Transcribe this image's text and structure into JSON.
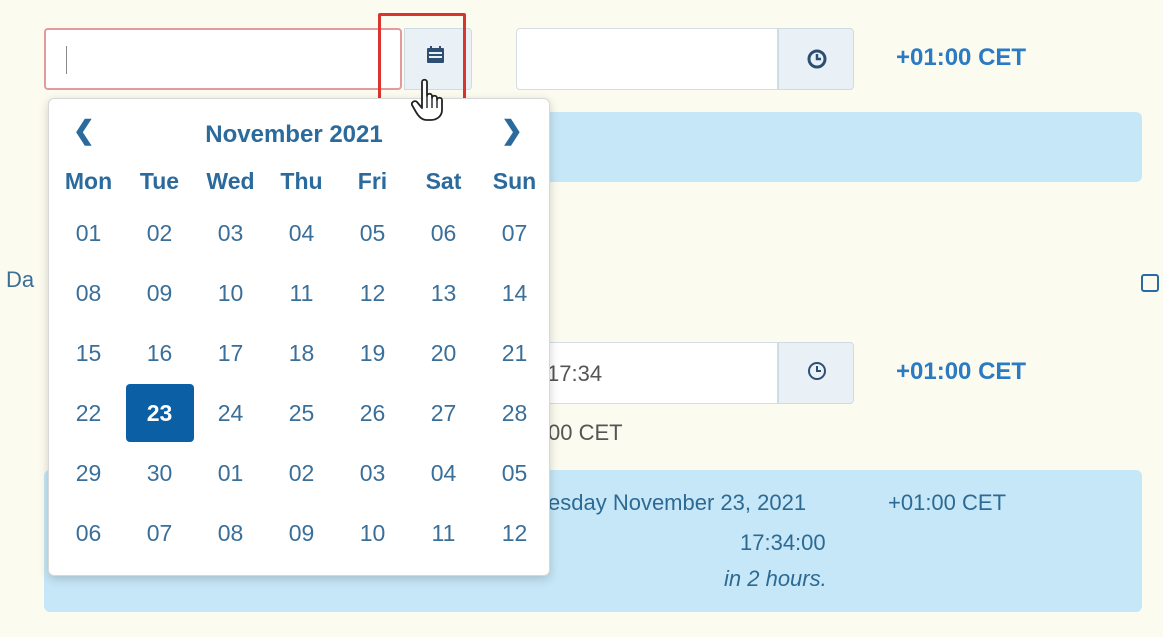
{
  "top": {
    "date_placeholder": "",
    "timezone": "+01:00 CET"
  },
  "datepicker": {
    "prev": "❮",
    "next": "❯",
    "month_title": "November 2021",
    "weekdays": [
      "Mon",
      "Tue",
      "Wed",
      "Thu",
      "Fri",
      "Sat",
      "Sun"
    ],
    "weeks": [
      [
        "01",
        "02",
        "03",
        "04",
        "05",
        "06",
        "07"
      ],
      [
        "08",
        "09",
        "10",
        "11",
        "12",
        "13",
        "14"
      ],
      [
        "15",
        "16",
        "17",
        "18",
        "19",
        "20",
        "21"
      ],
      [
        "22",
        "23",
        "24",
        "25",
        "26",
        "27",
        "28"
      ],
      [
        "29",
        "30",
        "01",
        "02",
        "03",
        "04",
        "05"
      ],
      [
        "06",
        "07",
        "08",
        "09",
        "10",
        "11",
        "12"
      ]
    ],
    "selected": "23"
  },
  "section": {
    "label_fragment": "Da"
  },
  "second": {
    "time_value": "17:34",
    "timezone": "+01:00 CET",
    "tz_fragment": "00 CET"
  },
  "summary": {
    "date_fragment": "esday November 23, 2021",
    "timezone": "+01:00 CET",
    "time": "17:34:00",
    "relative": "in 2 hours."
  },
  "icons": {
    "calendar": "calendar-icon",
    "clock": "clock-icon",
    "edit": "edit-icon",
    "cursor": "hand-pointer-icon"
  },
  "colors": {
    "accent": "#2b6a9c",
    "selected_day": "#0b5fa5",
    "info_bg": "#c6e7f8",
    "highlight": "#d9342f"
  }
}
